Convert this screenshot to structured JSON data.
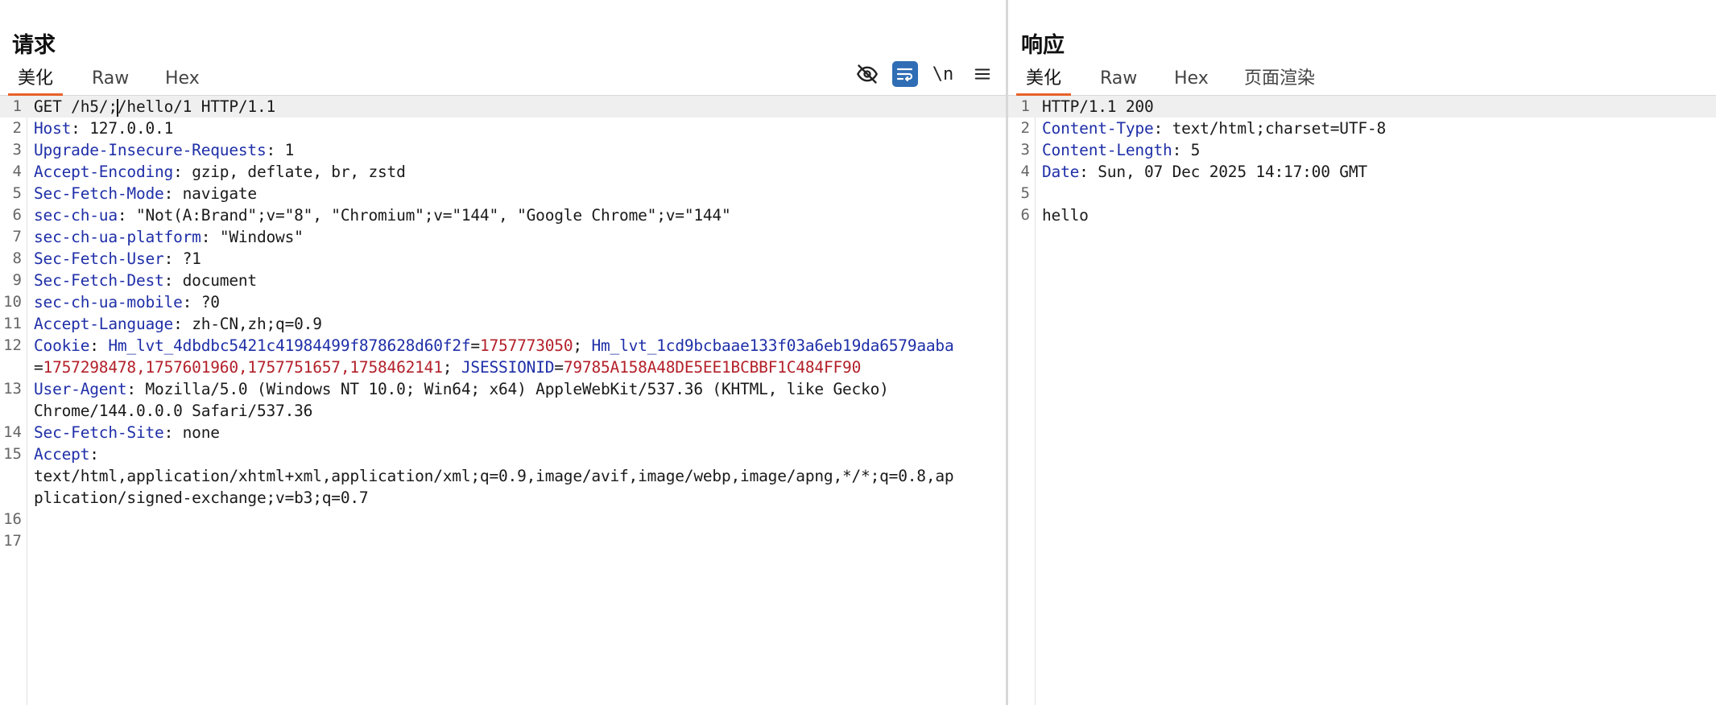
{
  "request": {
    "title": "请求",
    "tabs": [
      "美化",
      "Raw",
      "Hex"
    ],
    "toolbar": {
      "hide_icon": "eye-off-icon",
      "wrap_icon": "wrap-lines-icon",
      "newline_label": "\\n",
      "menu_icon": "menu-icon"
    },
    "lines": [
      {
        "n": "1",
        "text": "GET /h5/;/hello/1 HTTP/1.1"
      },
      {
        "n": "2",
        "key": "Host",
        "val": ": 127.0.0.1"
      },
      {
        "n": "3",
        "key": "Upgrade-Insecure-Requests",
        "val": ": 1"
      },
      {
        "n": "4",
        "key": "Accept-Encoding",
        "val": ": gzip, deflate, br, zstd"
      },
      {
        "n": "5",
        "key": "Sec-Fetch-Mode",
        "val": ": navigate"
      },
      {
        "n": "6",
        "key": "sec-ch-ua",
        "val": ": \"Not(A:Brand\";v=\"8\", \"Chromium\";v=\"144\", \"Google Chrome\";v=\"144\""
      },
      {
        "n": "7",
        "key": "sec-ch-ua-platform",
        "val": ": \"Windows\""
      },
      {
        "n": "8",
        "key": "Sec-Fetch-User",
        "val": ": ?1"
      },
      {
        "n": "9",
        "key": "Sec-Fetch-Dest",
        "val": ": document"
      },
      {
        "n": "10",
        "key": "sec-ch-ua-mobile",
        "val": ": ?0"
      },
      {
        "n": "11",
        "key": "Accept-Language",
        "val": ": zh-CN,zh;q=0.9"
      },
      {
        "n": "12",
        "cookie": {
          "key": "Cookie",
          "sep": ": ",
          "c1_name": "Hm_lvt_4dbdbc5421c41984499f878628d60f2f",
          "c1_eq": "=",
          "c1_val": "1757773050",
          "c1_sep": "; ",
          "c2_name": "Hm_lvt_1cd9bcbaae133f03a6eb19da6579aaba",
          "c2_eq": "=",
          "c2_val": "1757298478,1757601960,1757751657,1758462141",
          "c2_sep": "; ",
          "c3_name": "JSESSIONID",
          "c3_eq": "=",
          "c3_val": "79785A158A48DE5EE1BCBBF1C484FF90"
        }
      },
      {
        "n": "13",
        "key": "User-Agent",
        "val": ": Mozilla/5.0 (Windows NT 10.0; Win64; x64) AppleWebKit/537.36 (KHTML, like Gecko)",
        "cont": "Chrome/144.0.0.0 Safari/537.36"
      },
      {
        "n": "14",
        "key": "Sec-Fetch-Site",
        "val": ": none"
      },
      {
        "n": "15",
        "key": "Accept",
        "val": ":",
        "cont": "text/html,application/xhtml+xml,application/xml;q=0.9,image/avif,image/webp,image/apng,*/*;q=0.8,ap",
        "cont2": "plication/signed-exchange;v=b3;q=0.7"
      },
      {
        "n": "16"
      },
      {
        "n": "17"
      }
    ]
  },
  "response": {
    "title": "响应",
    "tabs": [
      "美化",
      "Raw",
      "Hex",
      "页面渲染"
    ],
    "lines": [
      {
        "n": "1",
        "text": "HTTP/1.1 200"
      },
      {
        "n": "2",
        "key": "Content-Type",
        "val": ": text/html;charset=UTF-8"
      },
      {
        "n": "3",
        "key": "Content-Length",
        "val": ": 5"
      },
      {
        "n": "4",
        "key": "Date",
        "val": ": Sun, 07 Dec 2025 14:17:00 GMT"
      },
      {
        "n": "5",
        "text": ""
      },
      {
        "n": "6",
        "text": "hello"
      }
    ]
  },
  "colors": {
    "accent": "#e8622a",
    "header_key": "#1f2fa8",
    "cookie_value": "#b3202a",
    "wrap_button": "#2f6db5"
  }
}
